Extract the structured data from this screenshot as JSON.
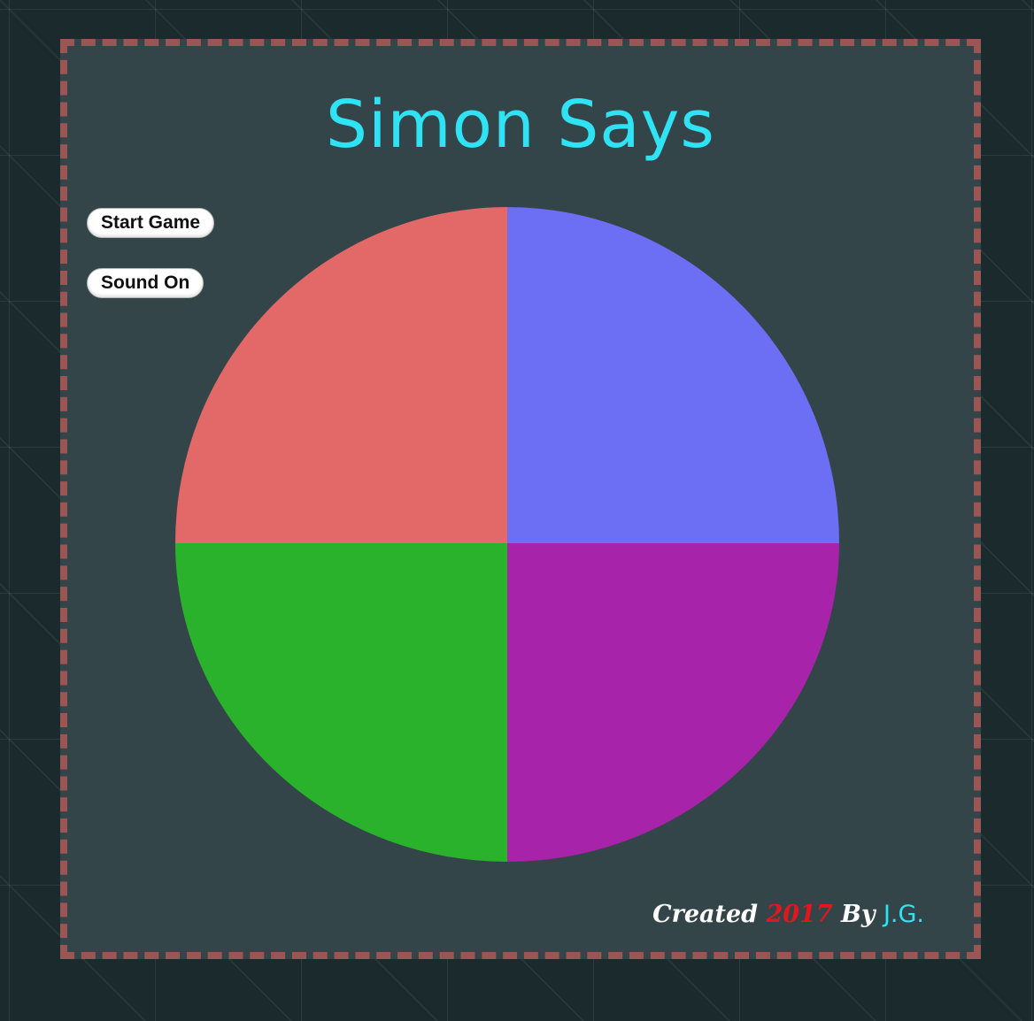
{
  "game": {
    "title": "Simon Says",
    "start_button": "Start Game",
    "sound_button": "Sound On",
    "pads": [
      {
        "name": "red",
        "color": "#e36868"
      },
      {
        "name": "blue",
        "color": "#6c6ef3"
      },
      {
        "name": "green",
        "color": "#2ab22d"
      },
      {
        "name": "purple",
        "color": "#a723aa"
      }
    ]
  },
  "footer": {
    "created": "Created",
    "year": "2017",
    "by": "By",
    "author": "J.G."
  },
  "colors": {
    "title": "#2fe3f5",
    "frame_border": "#9a5555",
    "frame_bg": "#334548",
    "page_bg": "#1b2a2c",
    "year": "#e0171e"
  }
}
